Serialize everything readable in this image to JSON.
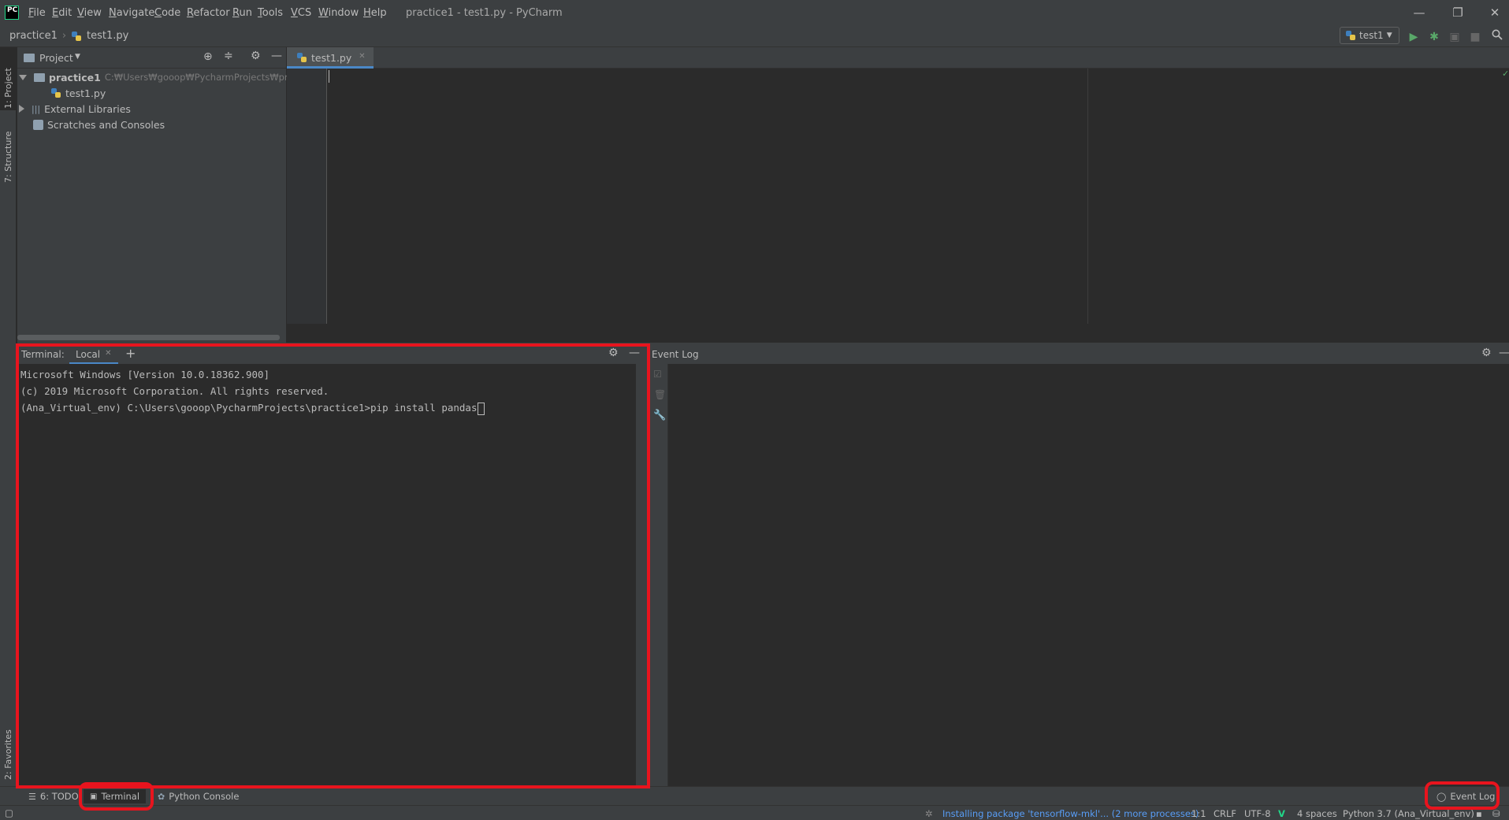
{
  "window": {
    "title": "practice1 - test1.py - PyCharm",
    "logo_text": "PC",
    "minimize": "—",
    "restore": "❐",
    "close": "✕"
  },
  "menu": [
    "File",
    "Edit",
    "View",
    "Navigate",
    "Code",
    "Refactor",
    "Run",
    "Tools",
    "VCS",
    "Window",
    "Help"
  ],
  "navbar": {
    "project": "practice1",
    "file": "test1.py",
    "run_config": "test1"
  },
  "left_stripe": {
    "project_tab": "1: Project",
    "structure_tab": "7: Structure",
    "favorites_tab": "2: Favorites"
  },
  "project_panel": {
    "title": "Project",
    "tree": {
      "root_name": "practice1",
      "root_path": "C:₩Users₩gooop₩PycharmProjects₩practice",
      "file": "test1.py",
      "external_libraries": "External Libraries",
      "scratches": "Scratches and Consoles"
    }
  },
  "editor": {
    "tab_label": "test1.py"
  },
  "terminal": {
    "label": "Terminal:",
    "tab": "Local",
    "lines": [
      "Microsoft Windows [Version 10.0.18362.900]",
      "(c) 2019 Microsoft Corporation. All rights reserved.",
      "(Ana_Virtual_env) C:\\Users\\gooop\\PycharmProjects\\practice1>pip install pandas"
    ]
  },
  "event_log": {
    "title": "Event Log"
  },
  "bottom_tabs": {
    "todo": "6: TODO",
    "terminal": "Terminal",
    "python_console": "Python Console",
    "event_log": "Event Log"
  },
  "status": {
    "progress_text": "Installing package 'tensorflow-mkl'... (2 more processes)",
    "position": "1:1",
    "line_sep": "CRLF",
    "encoding": "UTF-8",
    "indent": "4 spaces",
    "interpreter": "Python 3.7 (Ana_Virtual_env)"
  },
  "colors": {
    "background": "#2b2b2b",
    "panel": "#3c3f41",
    "accent": "#4a88c7",
    "highlight": "#e8141e",
    "run_green": "#59a869"
  }
}
